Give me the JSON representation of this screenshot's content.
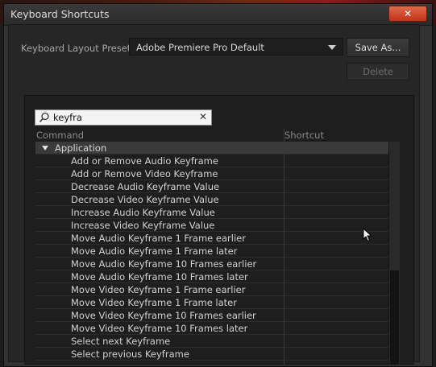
{
  "window": {
    "title": "Keyboard Shortcuts",
    "close_icon": "close-icon"
  },
  "preset": {
    "label": "Keyboard Layout Preset:",
    "value": "Adobe Premiere Pro Default",
    "save_label": "Save As...",
    "delete_label": "Delete"
  },
  "search": {
    "value": "keyfra"
  },
  "table": {
    "columns": [
      "Command",
      "Shortcut"
    ],
    "group": "Application",
    "rows": [
      "Add or Remove Audio Keyframe",
      "Add or Remove Video Keyframe",
      "Decrease Audio Keyframe Value",
      "Decrease Video Keyframe Value",
      "Increase Audio Keyframe Value",
      "Increase Video Keyframe Value",
      "Move Audio Keyframe 1 Frame earlier",
      "Move Audio Keyframe 1 Frame later",
      "Move Audio Keyframe 10 Frames earlier",
      "Move Audio Keyframe 10 Frames later",
      "Move Video Keyframe 1 Frame earlier",
      "Move Video Keyframe 1 Frame later",
      "Move Video Keyframe 10 Frames earlier",
      "Move Video Keyframe 10 Frames later",
      "Select next Keyframe",
      "Select previous Keyframe"
    ]
  },
  "colors": {
    "close_button": "#c0321a",
    "panel_bg": "#262626",
    "group_row": "#3a3a3a"
  }
}
